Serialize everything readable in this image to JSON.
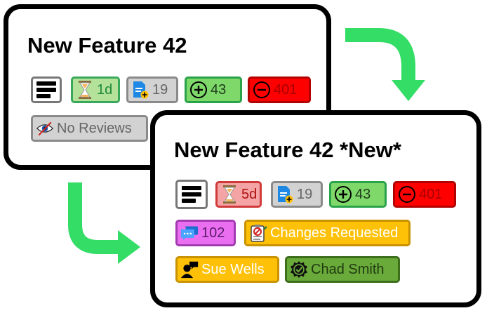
{
  "colors": {
    "arrow": "#33dd66",
    "card_border": "#000000",
    "approved": "#6aaa3a",
    "changes_requested": "#ffc107"
  },
  "card_old": {
    "title": "New Feature 42",
    "badges": {
      "menu_icon": "menu-lines-icon",
      "age": {
        "icon": "hourglass-icon",
        "text": "1d"
      },
      "files": {
        "icon": "file-plus-icon",
        "text": "19"
      },
      "additions": {
        "icon": "plus-circle-icon",
        "text": "43"
      },
      "deletions": {
        "icon": "minus-circle-icon",
        "text": "401"
      },
      "reviews": {
        "icon": "eye-off-icon",
        "text": "No Reviews"
      }
    }
  },
  "card_new": {
    "title": "New Feature 42 *New*",
    "badges": {
      "menu_icon": "menu-lines-icon",
      "age": {
        "icon": "hourglass-icon",
        "text": "5d"
      },
      "files": {
        "icon": "file-plus-icon",
        "text": "19"
      },
      "additions": {
        "icon": "plus-circle-icon",
        "text": "43"
      },
      "deletions": {
        "icon": "minus-circle-icon",
        "text": "401"
      },
      "comments": {
        "icon": "chat-bubbles-icon",
        "text": "102"
      },
      "status": {
        "icon": "clipboard-blocked-icon",
        "text": "Changes Requested"
      },
      "reviewer_1": {
        "icon": "person-speech-icon",
        "text": "Sue Wells"
      },
      "reviewer_2": {
        "icon": "approved-seal-icon",
        "text": "Chad Smith"
      }
    }
  }
}
